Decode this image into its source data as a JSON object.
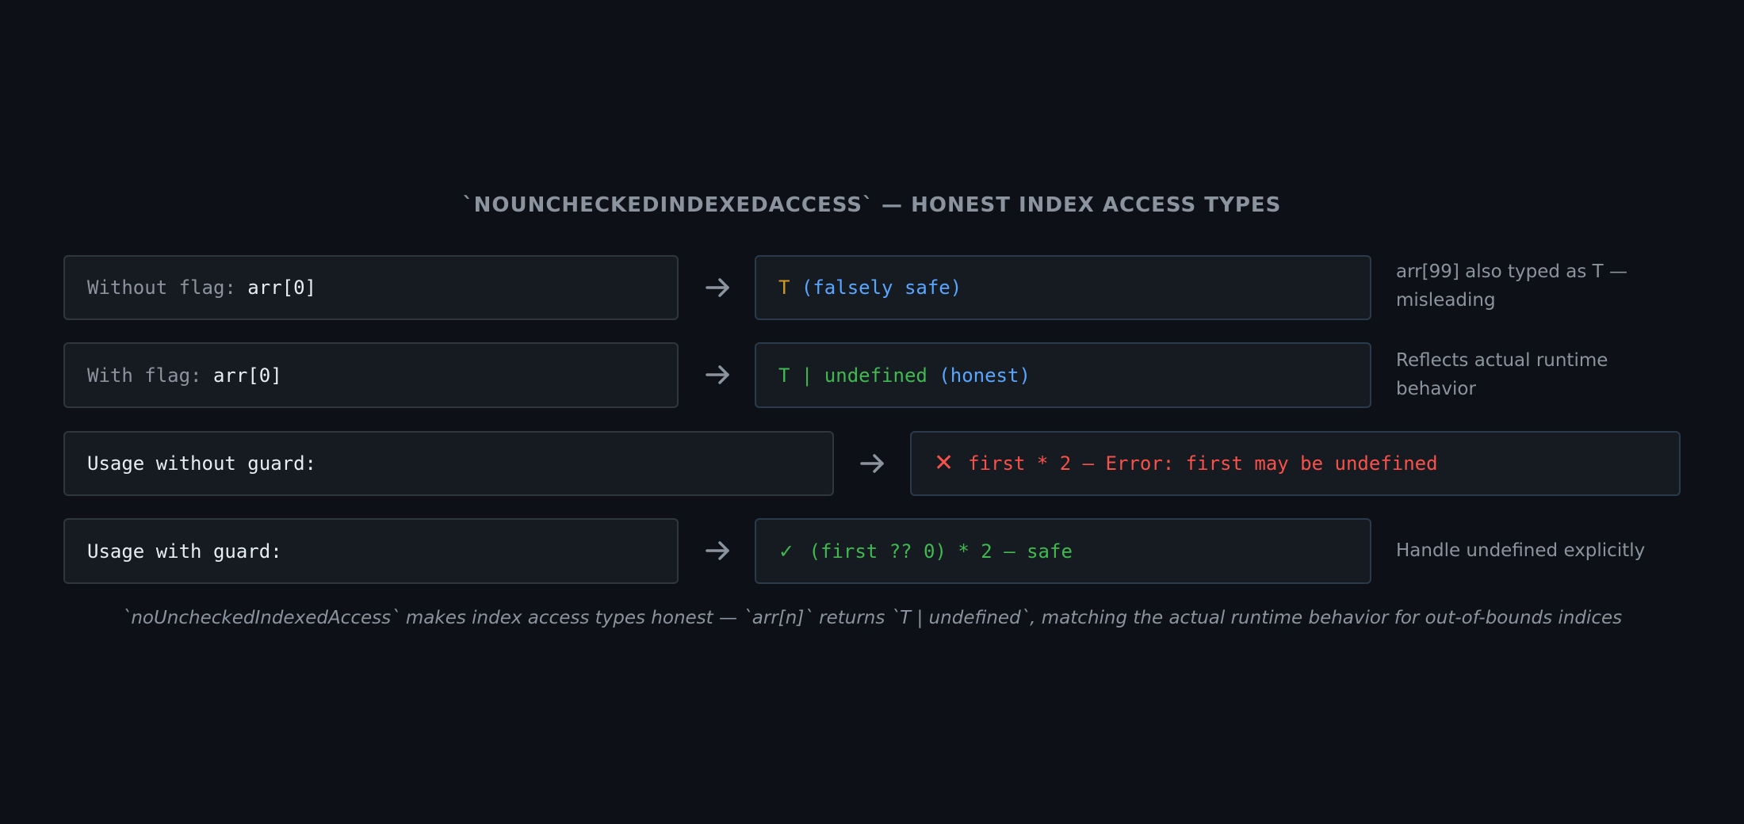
{
  "title": "`NOUNCHECKEDINDEXEDACCESS` — HONEST INDEX ACCESS TYPES",
  "rows": [
    {
      "input_label": "Without flag: ",
      "input_code": "arr[0]",
      "output_type": "T",
      "output_comment": " (falsely safe)",
      "note": "arr[99] also typed as T — misleading"
    },
    {
      "input_label": "With flag: ",
      "input_code": "arr[0]",
      "output_type": "T | undefined",
      "output_comment": " (honest)",
      "note": "Reflects actual runtime behavior"
    },
    {
      "input_label": "Usage without guard:",
      "output_icon": "x-icon",
      "output_text": "first * 2 — Error: first may be undefined"
    },
    {
      "input_label": "Usage with guard:",
      "output_icon": "check-icon",
      "output_icon_glyph": "✓",
      "output_text": " (first ?? 0) * 2 — safe",
      "note": "Handle undefined explicitly"
    }
  ],
  "caption": "`noUncheckedIndexedAccess` makes index access types honest — `arr[n]` returns `T | undefined`, matching the actual runtime behavior for out-of-bounds indices",
  "colors": {
    "background": "#0d1117",
    "box": "#161b22",
    "muted_text": "#8b949e",
    "type_orange": "#d29922",
    "comment_blue": "#58a6ff",
    "safe_green": "#3fb950",
    "error_red": "#f85149"
  }
}
